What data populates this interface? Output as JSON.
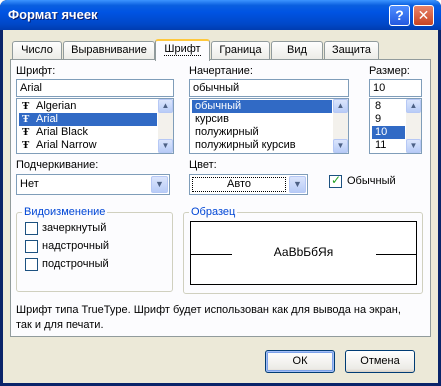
{
  "window": {
    "title": "Формат ячеек",
    "help_glyph": "?",
    "close_glyph": "✕"
  },
  "tabs": [
    {
      "label": "Число"
    },
    {
      "label": "Выравнивание"
    },
    {
      "label": "Шрифт",
      "active": true
    },
    {
      "label": "Граница"
    },
    {
      "label": "Вид"
    },
    {
      "label": "Защита"
    }
  ],
  "font": {
    "label": "Шрифт:",
    "value": "Arial",
    "items": [
      "Algerian",
      "Arial",
      "Arial Black",
      "Arial Narrow"
    ],
    "selected": "Arial",
    "item_icon": "truetype-icon"
  },
  "style": {
    "label": "Начертание:",
    "value": "обычный",
    "items": [
      "обычный",
      "курсив",
      "полужирный",
      "полужирный курсив"
    ],
    "selected": "обычный"
  },
  "size": {
    "label": "Размер:",
    "value": "10",
    "items": [
      "8",
      "9",
      "10",
      "11"
    ],
    "selected": "10"
  },
  "underline": {
    "label": "Подчеркивание:",
    "value": "Нет"
  },
  "color": {
    "label": "Цвет:",
    "value": "Авто"
  },
  "normal_font": {
    "label": "Обычный",
    "checked": true
  },
  "effects": {
    "title": "Видоизменение",
    "items": [
      {
        "label": "зачеркнутый",
        "checked": false
      },
      {
        "label": "надстрочный",
        "checked": false
      },
      {
        "label": "подстрочный",
        "checked": false
      }
    ]
  },
  "preview": {
    "title": "Образец",
    "text": "АаВbБбЯя"
  },
  "description": "Шрифт типа TrueType. Шрифт будет использован как для вывода на экран, так и для печати.",
  "buttons": {
    "ok": "ОК",
    "cancel": "Отмена"
  },
  "colors": {
    "selection": "#316ac5",
    "titlebar": "#0054e3",
    "group_title": "#0046d5",
    "panel": "#fcfcfe",
    "dialog": "#ece9d8"
  }
}
